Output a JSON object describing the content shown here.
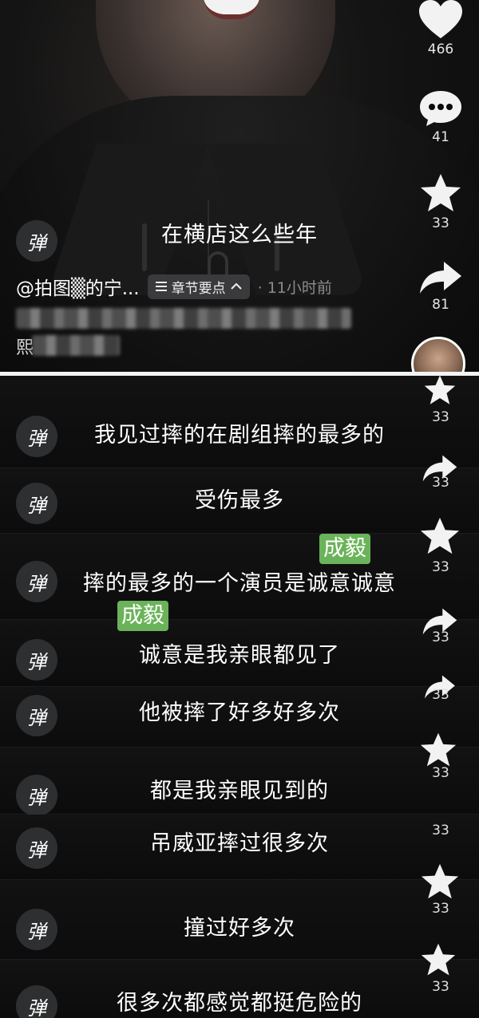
{
  "top": {
    "danmaku_icon": "弹",
    "caption": "在横店这么些年",
    "author": "@拍图▒的宁...",
    "chapter_label": "章节要点",
    "time_ago": "· 11小时前",
    "blurred_desc_char": "熙",
    "rail": {
      "likes": "466",
      "comments": "41",
      "favorites": "33",
      "shares": "81"
    }
  },
  "strips": [
    {
      "text": "我见过摔的在剧组摔的最多的",
      "count": "33"
    },
    {
      "text": "受伤最多",
      "count": "33"
    },
    {
      "text": "摔的最多的一个演员是诚意诚意",
      "count": "33"
    },
    {
      "text": "诚意是我亲眼都见了",
      "count": "33"
    },
    {
      "text": "他被摔了好多好多次",
      "count": "33"
    },
    {
      "text": "都是我亲眼见到的",
      "count": "33"
    },
    {
      "text": "吊威亚摔过很多次",
      "count": "33"
    },
    {
      "text": "撞过好多次",
      "count": "33"
    },
    {
      "text": "很多次都感觉都挺危险的",
      "count": "33"
    }
  ],
  "highlights": [
    "成毅",
    "成毅"
  ],
  "colors": {
    "highlight": "#6bb35a",
    "bg": "#0b0b0c"
  }
}
